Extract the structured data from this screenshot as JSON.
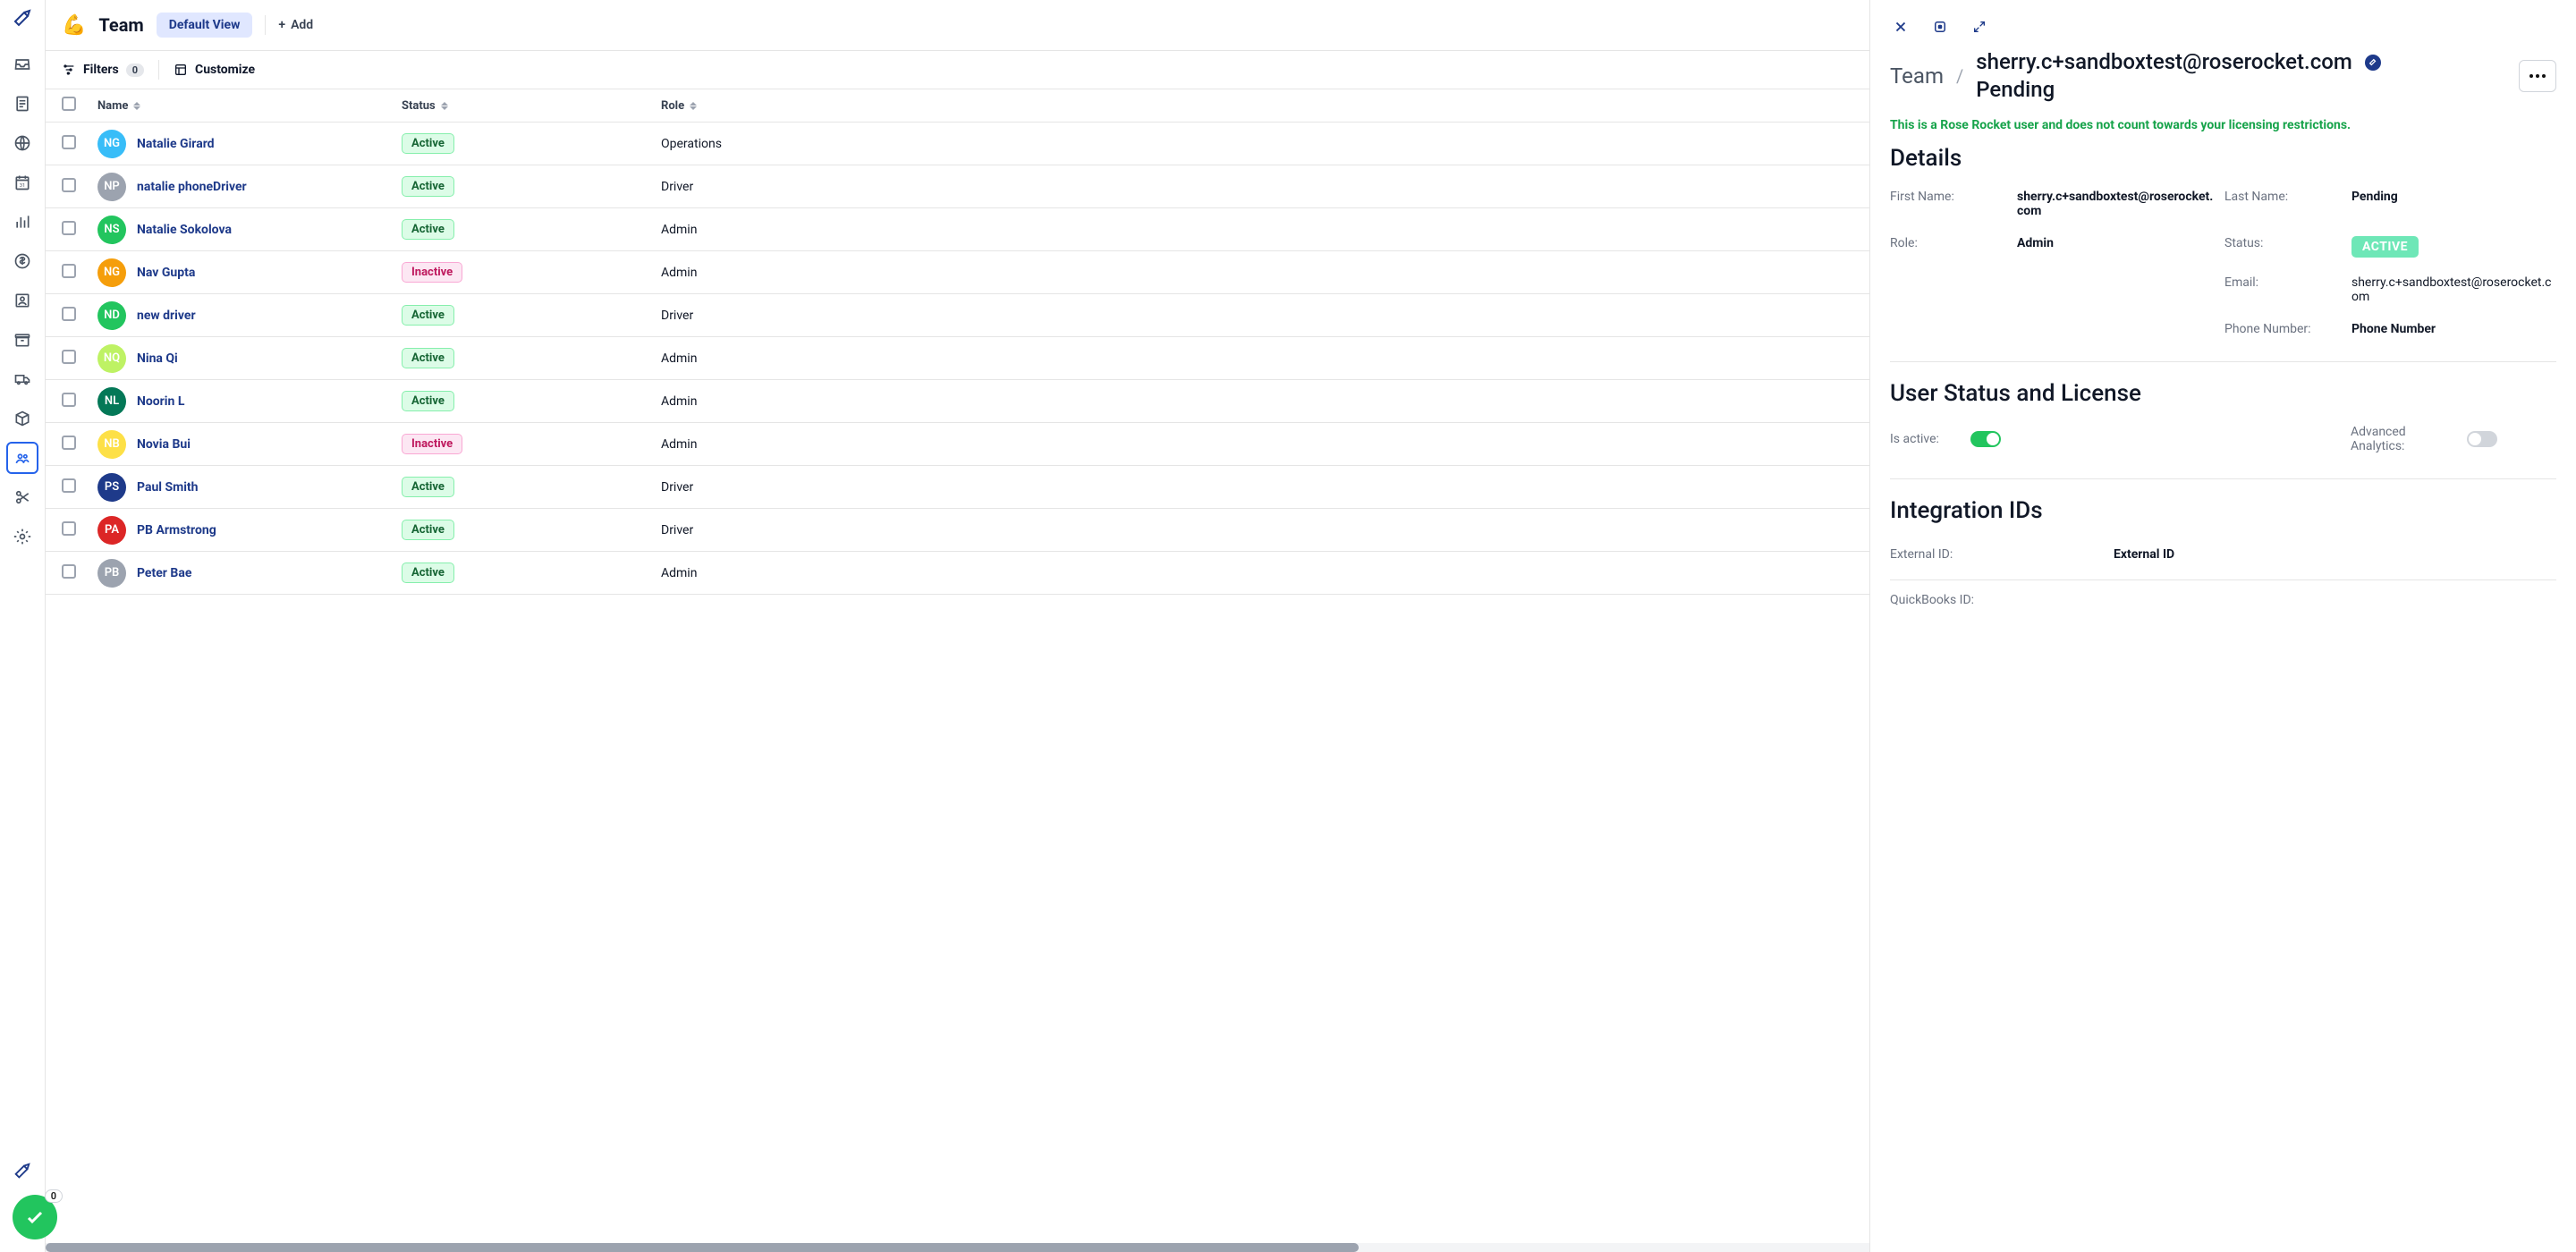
{
  "header": {
    "emoji": "💪",
    "title": "Team",
    "view_label": "Default View",
    "add_label": "Add"
  },
  "toolbar": {
    "filters_label": "Filters",
    "filters_count": "0",
    "customize_label": "Customize"
  },
  "columns": {
    "name": "Name",
    "status": "Status",
    "role": "Role"
  },
  "rows": [
    {
      "initials": "NG",
      "color": "#38bdf8",
      "name": "Natalie Girard",
      "status": "Active",
      "role": "Operations"
    },
    {
      "initials": "NP",
      "color": "#9ca3af",
      "name": "natalie phoneDriver",
      "status": "Active",
      "role": "Driver"
    },
    {
      "initials": "NS",
      "color": "#22c55e",
      "name": "Natalie Sokolova",
      "status": "Active",
      "role": "Admin"
    },
    {
      "initials": "NG",
      "color": "#f59e0b",
      "name": "Nav Gupta",
      "status": "Inactive",
      "role": "Admin"
    },
    {
      "initials": "ND",
      "color": "#22c55e",
      "name": "new driver",
      "status": "Active",
      "role": "Driver"
    },
    {
      "initials": "NQ",
      "color": "#bef264",
      "name": "Nina Qi",
      "status": "Active",
      "role": "Admin"
    },
    {
      "initials": "NL",
      "color": "#047857",
      "name": "Noorin L",
      "status": "Active",
      "role": "Admin"
    },
    {
      "initials": "NB",
      "color": "#fde047",
      "name": "Novia Bui",
      "status": "Inactive",
      "role": "Admin"
    },
    {
      "initials": "PS",
      "color": "#1e3a8a",
      "name": "Paul Smith",
      "status": "Active",
      "role": "Driver"
    },
    {
      "initials": "PA",
      "color": "#dc2626",
      "name": "PB Armstrong",
      "status": "Active",
      "role": "Driver"
    },
    {
      "initials": "PB",
      "color": "#9ca3af",
      "name": "Peter Bae",
      "status": "Active",
      "role": "Admin"
    }
  ],
  "fab_badge": "0",
  "panel": {
    "breadcrumb_root": "Team",
    "title_line1": "sherry.c+sandboxtest@roserocket.com",
    "title_line2": "Pending",
    "notice": "This is a Rose Rocket user and does not count towards your licensing restrictions.",
    "sections": {
      "details": "Details",
      "status_license": "User Status and License",
      "integration": "Integration IDs"
    },
    "labels": {
      "first_name": "First Name:",
      "last_name": "Last Name:",
      "role": "Role:",
      "status": "Status:",
      "email": "Email:",
      "phone": "Phone Number:",
      "is_active": "Is active:",
      "advanced_analytics": "Advanced Analytics:",
      "external_id": "External ID:",
      "quickbooks_id": "QuickBooks ID:"
    },
    "values": {
      "first_name": "sherry.c+sandboxtest@roserocket.com",
      "last_name": "Pending",
      "role": "Admin",
      "status": "ACTIVE",
      "email": "sherry.c+sandboxtest@roserocket.com",
      "phone": "Phone Number",
      "external_id": "External ID"
    },
    "toggles": {
      "is_active": true,
      "advanced_analytics": false
    }
  }
}
